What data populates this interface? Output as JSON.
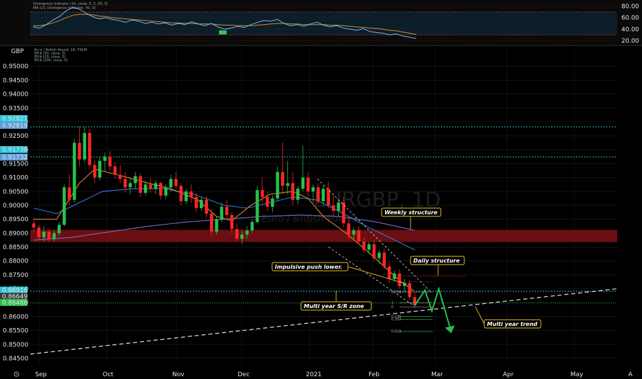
{
  "header": {
    "currency": "GBP",
    "legend_lines": [
      "Euro / British Pound, 1D, FXCM",
      "EMA (50, close, 0)",
      "EMA (20, close, 0)",
      "EMA (200, close, 0)"
    ],
    "watermark_symbol": "EURGBP, 1D",
    "watermark_name": "Euro / British Pound"
  },
  "oscillator": {
    "legend_lines": [
      "Divergence Indicator (10, close, 5, 5, 60, 5)",
      "MA (10, Divergence Indicator, 45, 0)"
    ],
    "ticks": [
      "80.00",
      "60.00",
      "40.00",
      "20.00"
    ],
    "tick_values": [
      80,
      60,
      40,
      20
    ],
    "ylim": [
      14,
      86
    ],
    "bull_label": "Bull"
  },
  "chart_data": {
    "type": "candlestick",
    "ylim": [
      0.843,
      0.957
    ],
    "yticks": [
      0.845,
      0.85,
      0.855,
      0.86,
      0.865,
      0.87,
      0.875,
      0.88,
      0.885,
      0.89,
      0.895,
      0.9,
      0.905,
      0.91,
      0.915,
      0.92,
      0.925,
      0.93,
      0.935,
      0.94,
      0.945,
      0.95
    ],
    "ytick_labels": [
      "0.84500",
      "0.85000",
      "0.85500",
      "0.86000",
      "0.86500",
      "0.87000",
      "0.87500",
      "0.88000",
      "0.88500",
      "0.89000",
      "0.89500",
      "0.90000",
      "0.90500",
      "0.91000",
      "0.91500",
      "0.92000",
      "0.92500",
      "0.93000",
      "0.93500",
      "0.94000",
      "0.94500",
      "0.95000"
    ],
    "xlabels": [
      "Sep",
      "Oct",
      "Nov",
      "Dec",
      "2021",
      "Feb",
      "Mar",
      "Apr",
      "May"
    ],
    "price_tags": [
      {
        "label": "0.92821",
        "value": 0.92821,
        "color": "#2bc3d8"
      },
      {
        "label": "0.92819",
        "value": 0.9268,
        "color": "#5b9bd5"
      },
      {
        "label": "0.91738",
        "value": 0.91738,
        "color": "#2bc3d8"
      },
      {
        "label": "0.91732",
        "value": 0.9158,
        "color": "#5b9bd5"
      },
      {
        "label": "0.86916",
        "value": 0.86916,
        "color": "#2bc3d8"
      },
      {
        "label": "0.86649",
        "value": 0.86649,
        "color": "#3a3a3a"
      },
      {
        "label": "0.86486",
        "value": 0.86486,
        "color": "#26c24b"
      }
    ],
    "sr_zone": [
      0.8868,
      0.8912
    ],
    "candles": [
      [
        0.8935,
        0.8955,
        0.8905,
        0.892
      ],
      [
        0.892,
        0.893,
        0.8875,
        0.8885
      ],
      [
        0.8885,
        0.8925,
        0.887,
        0.8905
      ],
      [
        0.8905,
        0.8915,
        0.8868,
        0.8878
      ],
      [
        0.8878,
        0.891,
        0.887,
        0.89
      ],
      [
        0.89,
        0.894,
        0.889,
        0.893
      ],
      [
        0.893,
        0.9075,
        0.8925,
        0.9065
      ],
      [
        0.9065,
        0.911,
        0.9,
        0.902
      ],
      [
        0.902,
        0.924,
        0.901,
        0.9225
      ],
      [
        0.9225,
        0.9285,
        0.914,
        0.9165
      ],
      [
        0.9165,
        0.9282,
        0.9155,
        0.926
      ],
      [
        0.926,
        0.9275,
        0.913,
        0.9145
      ],
      [
        0.9145,
        0.9165,
        0.908,
        0.91
      ],
      [
        0.91,
        0.9175,
        0.909,
        0.916
      ],
      [
        0.916,
        0.919,
        0.912,
        0.9175
      ],
      [
        0.9175,
        0.9195,
        0.9125,
        0.914
      ],
      [
        0.914,
        0.9155,
        0.9095,
        0.911
      ],
      [
        0.911,
        0.9145,
        0.908,
        0.9095
      ],
      [
        0.9095,
        0.912,
        0.9045,
        0.9065
      ],
      [
        0.9065,
        0.9095,
        0.904,
        0.908
      ],
      [
        0.908,
        0.912,
        0.906,
        0.9105
      ],
      [
        0.9105,
        0.9115,
        0.903,
        0.9045
      ],
      [
        0.9045,
        0.909,
        0.9035,
        0.9075
      ],
      [
        0.9075,
        0.91,
        0.9045,
        0.906
      ],
      [
        0.906,
        0.909,
        0.904,
        0.908
      ],
      [
        0.908,
        0.9085,
        0.902,
        0.9035
      ],
      [
        0.9035,
        0.9075,
        0.9025,
        0.9065
      ],
      [
        0.9065,
        0.911,
        0.905,
        0.9095
      ],
      [
        0.9095,
        0.912,
        0.906,
        0.907
      ],
      [
        0.907,
        0.908,
        0.9,
        0.9015
      ],
      [
        0.9015,
        0.906,
        0.9005,
        0.905
      ],
      [
        0.905,
        0.9075,
        0.901,
        0.903
      ],
      [
        0.903,
        0.9045,
        0.8975,
        0.899
      ],
      [
        0.899,
        0.903,
        0.898,
        0.902
      ],
      [
        0.902,
        0.9035,
        0.8955,
        0.897
      ],
      [
        0.897,
        0.8985,
        0.889,
        0.8905
      ],
      [
        0.8905,
        0.896,
        0.8895,
        0.895
      ],
      [
        0.895,
        0.901,
        0.894,
        0.8995
      ],
      [
        0.8995,
        0.902,
        0.895,
        0.8965
      ],
      [
        0.8965,
        0.8975,
        0.89,
        0.8915
      ],
      [
        0.8915,
        0.8935,
        0.887,
        0.888
      ],
      [
        0.888,
        0.891,
        0.886,
        0.8895
      ],
      [
        0.8895,
        0.8925,
        0.888,
        0.891
      ],
      [
        0.891,
        0.895,
        0.89,
        0.894
      ],
      [
        0.894,
        0.907,
        0.8935,
        0.9055
      ],
      [
        0.9055,
        0.91,
        0.901,
        0.903
      ],
      [
        0.903,
        0.905,
        0.898,
        0.8995
      ],
      [
        0.8995,
        0.9035,
        0.8975,
        0.9025
      ],
      [
        0.9025,
        0.914,
        0.9015,
        0.912
      ],
      [
        0.912,
        0.9225,
        0.904,
        0.907
      ],
      [
        0.907,
        0.916,
        0.904,
        0.908
      ],
      [
        0.908,
        0.912,
        0.9,
        0.902
      ],
      [
        0.902,
        0.907,
        0.9005,
        0.906
      ],
      [
        0.906,
        0.9215,
        0.905,
        0.91
      ],
      [
        0.91,
        0.912,
        0.903,
        0.905
      ],
      [
        0.905,
        0.9075,
        0.901,
        0.9065
      ],
      [
        0.9065,
        0.908,
        0.9005,
        0.9015
      ],
      [
        0.9015,
        0.907,
        0.9,
        0.906
      ],
      [
        0.906,
        0.9085,
        0.899,
        0.9
      ],
      [
        0.9,
        0.904,
        0.896,
        0.898
      ],
      [
        0.898,
        0.902,
        0.896,
        0.901
      ],
      [
        0.901,
        0.903,
        0.892,
        0.8935
      ],
      [
        0.8935,
        0.8955,
        0.888,
        0.8895
      ],
      [
        0.8895,
        0.892,
        0.8875,
        0.891
      ],
      [
        0.891,
        0.8925,
        0.886,
        0.887
      ],
      [
        0.887,
        0.8885,
        0.883,
        0.884
      ],
      [
        0.884,
        0.887,
        0.8825,
        0.886
      ],
      [
        0.886,
        0.8875,
        0.88,
        0.881
      ],
      [
        0.881,
        0.884,
        0.879,
        0.883
      ],
      [
        0.883,
        0.8845,
        0.877,
        0.878
      ],
      [
        0.878,
        0.88,
        0.872,
        0.8735
      ],
      [
        0.8735,
        0.8765,
        0.8725,
        0.8755
      ],
      [
        0.8755,
        0.877,
        0.87,
        0.871
      ],
      [
        0.871,
        0.8735,
        0.869,
        0.872
      ],
      [
        0.872,
        0.873,
        0.866,
        0.867
      ],
      [
        0.867,
        0.8685,
        0.863,
        0.864
      ]
    ],
    "ema20": [
      [
        0,
        0.895
      ],
      [
        0.06,
        0.895
      ],
      [
        0.12,
        0.908
      ],
      [
        0.16,
        0.913
      ],
      [
        0.22,
        0.911
      ],
      [
        0.3,
        0.908
      ],
      [
        0.36,
        0.906
      ],
      [
        0.43,
        0.902
      ],
      [
        0.48,
        0.896
      ],
      [
        0.52,
        0.8945
      ],
      [
        0.57,
        0.9
      ],
      [
        0.62,
        0.904
      ],
      [
        0.68,
        0.905
      ],
      [
        0.72,
        0.9025
      ],
      [
        0.76,
        0.896
      ],
      [
        0.82,
        0.89
      ],
      [
        0.88,
        0.883
      ],
      [
        0.92,
        0.878
      ],
      [
        0.96,
        0.873
      ],
      [
        1.0,
        0.869
      ]
    ],
    "ema50": [
      [
        0,
        0.899
      ],
      [
        0.06,
        0.897
      ],
      [
        0.12,
        0.901
      ],
      [
        0.18,
        0.905
      ],
      [
        0.26,
        0.906
      ],
      [
        0.34,
        0.906
      ],
      [
        0.42,
        0.904
      ],
      [
        0.5,
        0.9
      ],
      [
        0.56,
        0.899
      ],
      [
        0.62,
        0.901
      ],
      [
        0.68,
        0.903
      ],
      [
        0.74,
        0.902
      ],
      [
        0.8,
        0.898
      ],
      [
        0.88,
        0.892
      ],
      [
        0.94,
        0.888
      ],
      [
        1.0,
        0.884
      ]
    ],
    "ema200": [
      [
        0,
        0.8875
      ],
      [
        0.1,
        0.8885
      ],
      [
        0.2,
        0.8905
      ],
      [
        0.3,
        0.8925
      ],
      [
        0.4,
        0.894
      ],
      [
        0.5,
        0.895
      ],
      [
        0.6,
        0.896
      ],
      [
        0.7,
        0.8965
      ],
      [
        0.8,
        0.896
      ],
      [
        0.9,
        0.894
      ],
      [
        1.0,
        0.891
      ]
    ],
    "trendline": {
      "from": [
        0.0,
        0.8465
      ],
      "to": [
        1.0,
        0.87
      ]
    },
    "annotations": [
      {
        "text": "Weekly structure",
        "value": 0.8944
      },
      {
        "text": "Daily structure",
        "value": 0.8771
      },
      {
        "text": "Impulsive push lower.",
        "value": 0.8735
      },
      {
        "text": "Multi year S/R zone",
        "value": 0.8629
      },
      {
        "text": "Multi year trend",
        "value": 0.8583
      }
    ],
    "fib_levels": [
      {
        "label": "0.786",
        "value": 0.8688
      },
      {
        "label": "1",
        "value": 0.865
      },
      {
        "label": "0",
        "value": 0.8634
      },
      {
        "label": "0.236",
        "value": 0.86
      },
      {
        "label": "0.382",
        "value": 0.859
      },
      {
        "label": "0.618",
        "value": 0.8546
      }
    ]
  },
  "colors": {
    "up": "#26c24b",
    "down": "#ff2525",
    "ema20": "#e08a2a",
    "ema50": "#2f7bd6",
    "ema200": "#7b69c7",
    "zone": "#7a0f14",
    "cyan": "#2bc3d8",
    "green": "#26c24b",
    "callout_border": "#f0c419"
  },
  "bottom_bar": {
    "left_icon": "gear-icon",
    "right_label": "A"
  }
}
